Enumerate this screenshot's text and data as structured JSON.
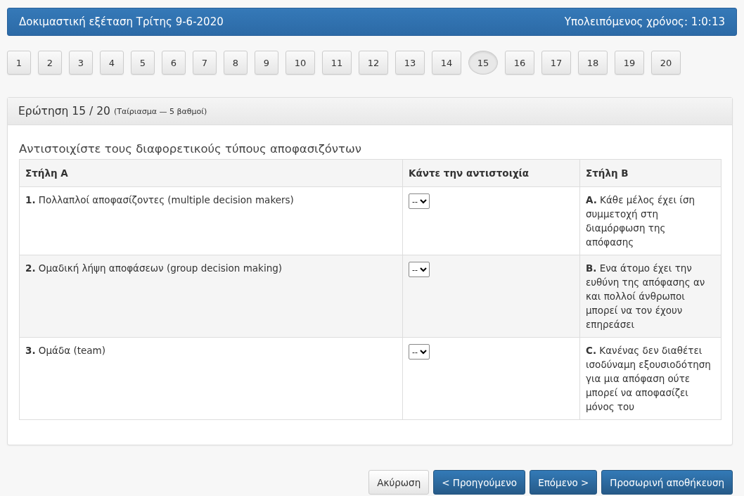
{
  "header": {
    "title": "Δοκιμαστική εξέταση Τρίτης 9-6-2020",
    "timer": "Υπολειπόμενος χρόνος: 1:0:13"
  },
  "question_nav": [
    {
      "label": "1",
      "selected": false
    },
    {
      "label": "2",
      "selected": false
    },
    {
      "label": "3",
      "selected": false
    },
    {
      "label": "4",
      "selected": false
    },
    {
      "label": "5",
      "selected": false
    },
    {
      "label": "6",
      "selected": false
    },
    {
      "label": "7",
      "selected": false
    },
    {
      "label": "8",
      "selected": false
    },
    {
      "label": "9",
      "selected": false
    },
    {
      "label": "10",
      "selected": false
    },
    {
      "label": "11",
      "selected": false
    },
    {
      "label": "12",
      "selected": false
    },
    {
      "label": "13",
      "selected": false
    },
    {
      "label": "14",
      "selected": false
    },
    {
      "label": "15",
      "selected": true
    },
    {
      "label": "16",
      "selected": false
    },
    {
      "label": "17",
      "selected": false
    },
    {
      "label": "18",
      "selected": false
    },
    {
      "label": "19",
      "selected": false
    },
    {
      "label": "20",
      "selected": false
    }
  ],
  "question": {
    "title": "Ερώτηση 15 / 20",
    "subtitle": "(Ταίριασμα — 5 βαθμοί)",
    "prompt": "Αντιστοιχίστε τους διαφορετικούς τύπους αποφασιζόντων",
    "table": {
      "columns": [
        "Στήλη Α",
        "Κάντε την αντιστοιχία",
        "Στήλη Β"
      ],
      "rows": [
        {
          "left": "**1.** Πολλαπλοί αποφασίζοντες (multiple decision makers)",
          "match": "--",
          "right": "**A.** Κάθε μέλος έχει ίση συμμετοχή στη διαμόρφωση της απόφασης"
        },
        {
          "left": "**2.** Ομαδική λήψη αποφάσεων (group decision making)",
          "match": "--",
          "right": "**B.** Ενα άτομο έχει την ευθύνη της απόφασης αν και πολλοί άνθρωποι μπορεί να τον έχουν επηρεάσει"
        },
        {
          "left": "**3.** Ομάδα (team)",
          "match": "--",
          "right": "**C.** Κανένας δεν διαθέτει ισοδύναμη εξουσιοδότηση για μια απόφαση ούτε μπορεί να αποφασίζει μόνος του"
        }
      ]
    }
  },
  "actions": [
    {
      "label": "Ακύρωση",
      "kind": "default"
    },
    {
      "label": "< Προηγούμενο",
      "kind": "primary"
    },
    {
      "label": "Επόμενο >",
      "kind": "primary"
    },
    {
      "label": "Προσωρινή αποθήκευση",
      "kind": "primary"
    }
  ]
}
